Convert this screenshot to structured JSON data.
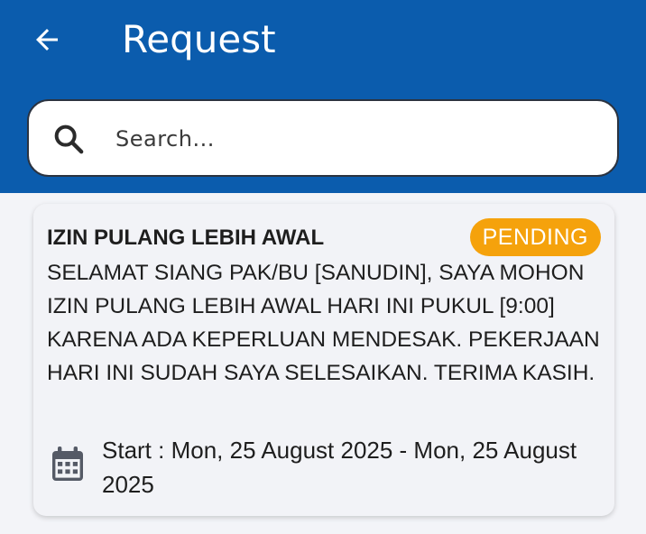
{
  "header": {
    "title": "Request",
    "back_icon": "arrow-left-icon",
    "background_color": "#0b5cad"
  },
  "search": {
    "placeholder": "Search...",
    "icon": "search-icon"
  },
  "requests": [
    {
      "title": "IZIN PULANG LEBIH AWAL",
      "status": "PENDING",
      "status_color": "#f5a20c",
      "message": "SELAMAT SIANG PAK/BU [SANUDIN], SAYA MOHON IZIN PULANG LEBIH AWAL HARI INI PUKUL [9:00] KARENA ADA KEPERLUAN MENDESAK. PEKERJAAN HARI INI SUDAH SAYA SELESAIKAN. TERIMA KASIH.",
      "date_icon": "calendar-icon",
      "date_range": "Start : Mon, 25 August 2025 - Mon, 25 August 2025"
    }
  ]
}
